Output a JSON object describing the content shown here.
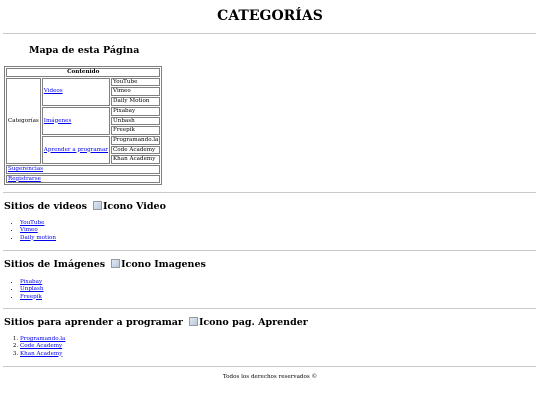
{
  "header": {
    "title": "CATEGORÍAS"
  },
  "sitemap": {
    "heading": "Mapa de esta Página",
    "table_header": "Contenido",
    "category_label": "Categorías",
    "groups": [
      {
        "label": "Videos",
        "items": [
          "YouTube",
          "Vimeo",
          "Daily Motion"
        ]
      },
      {
        "label": "Imágenes",
        "items": [
          "Pixabay",
          "Unbash",
          "Freepik"
        ]
      },
      {
        "label": "Aprender a programar",
        "items": [
          "Programando.la",
          "Code Academy",
          "Khan Academy"
        ]
      }
    ],
    "extra_links": [
      "Sugerencias",
      "Registrarse"
    ]
  },
  "sections": {
    "videos": {
      "heading": "Sitios de videos",
      "icon_alt": "Icono Video",
      "links": [
        "YouTube",
        "Vimeo",
        "Daily motion"
      ]
    },
    "images": {
      "heading": "Sitios de Imágenes",
      "icon_alt": "Icono Imagenes",
      "links": [
        "Pixabay",
        "Unplash",
        "Freepik"
      ]
    },
    "programming": {
      "heading": "Sitios para aprender a programar",
      "icon_alt": "Icono pag. Aprender",
      "links": [
        "Programando.la",
        "Code Academy",
        "Khan Academy"
      ]
    }
  },
  "footer": {
    "text": "Todos los derechos reservados ©"
  },
  "colors": {
    "link": "#0000ee",
    "divider": "#c9c9c9",
    "table_border": "#808080"
  }
}
